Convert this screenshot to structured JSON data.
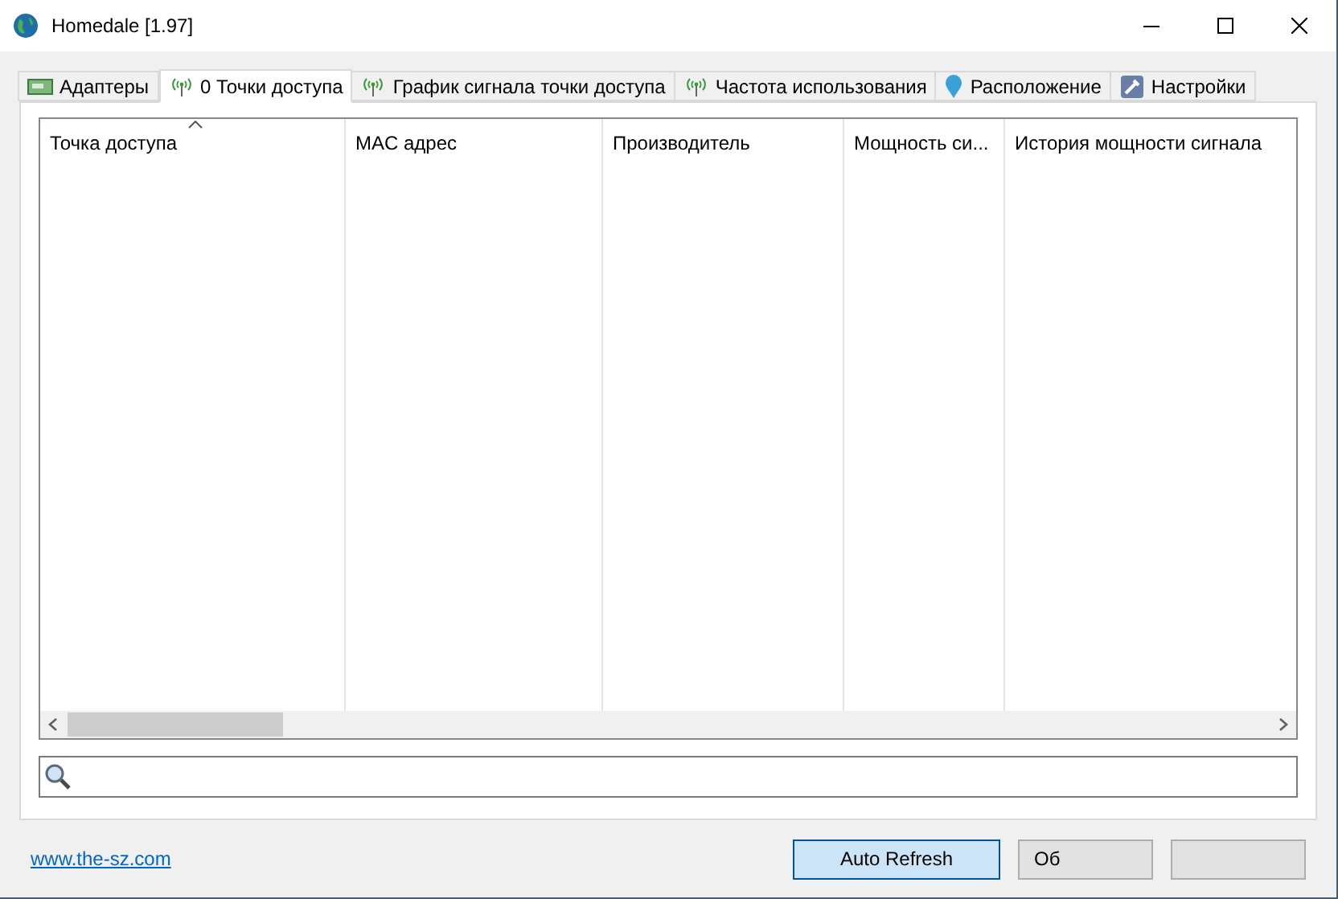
{
  "window": {
    "title": "Homedale [1.97]"
  },
  "tabs": [
    {
      "label": "Адаптеры",
      "selected": false,
      "kind": "adapter"
    },
    {
      "label": "0 Точки доступа",
      "selected": true,
      "kind": "antenna"
    },
    {
      "label": "График сигнала точки доступа",
      "selected": false,
      "kind": "antenna"
    },
    {
      "label": "Частота использования",
      "selected": false,
      "kind": "antenna"
    },
    {
      "label": "Расположение",
      "selected": false,
      "kind": "pin"
    },
    {
      "label": "Настройки",
      "selected": false,
      "kind": "settings"
    }
  ],
  "table": {
    "columns": [
      {
        "label": "Точка доступа",
        "sorted": true
      },
      {
        "label": "MAC адрес",
        "sorted": false
      },
      {
        "label": "Производитель",
        "sorted": false
      },
      {
        "label": "Мощность си...",
        "sorted": false
      },
      {
        "label": "История мощности сигнала",
        "sorted": false
      }
    ]
  },
  "footer": {
    "link": "www.the-sz.com",
    "buttons": [
      {
        "label": "Auto Refresh",
        "selected": true
      },
      {
        "label": "Об",
        "selected": false
      }
    ]
  }
}
